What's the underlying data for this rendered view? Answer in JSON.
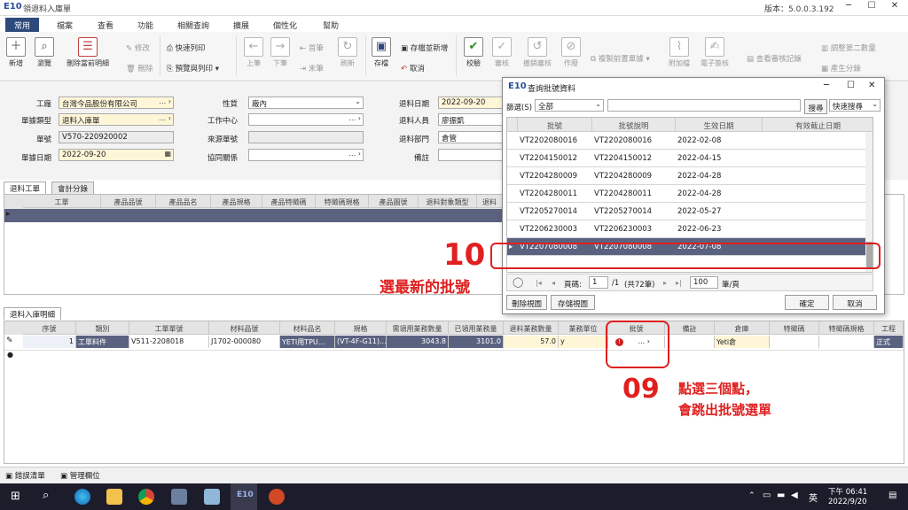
{
  "window": {
    "logo": "E10",
    "title": "領退料入庫單",
    "version": "版本：5.0.0.3.192"
  },
  "menu_tabs": [
    "常用",
    "檔案",
    "查看",
    "功能",
    "相關查詢",
    "擴展",
    "個性化",
    "幫助"
  ],
  "ribbon": {
    "new": "新增",
    "browse": "瀏覽",
    "delete_current": "刪除當前明細",
    "modify": "修改",
    "remove": "刪除",
    "quick_print": "快速列印",
    "preview_print": "預覽與列印",
    "prev": "上筆",
    "next": "下筆",
    "first": "首筆",
    "last": "末筆",
    "refresh": "刷新",
    "save": "存檔",
    "save_add": "存檔並新增",
    "cancel": "取消",
    "validate": "校驗",
    "approve": "審核",
    "undo_approve": "撤銷審核",
    "void": "作廢",
    "copy_prev": "複製前置單據",
    "attach": "附加檔",
    "esign": "電子簽核",
    "view_log": "查看審核記錄",
    "adjust_qty": "調整第二數量",
    "gen_batch": "產生分錄"
  },
  "form": {
    "factory_label": "工廠",
    "factory_value": "台灣今品股份有限公司",
    "doctype_label": "單據類型",
    "doctype_value": "退料入庫單",
    "docno_label": "單號",
    "docno_value": "V570-220920002",
    "docdate_label": "單據日期",
    "docdate_value": "2022-09-20",
    "nature_label": "性質",
    "nature_value": "廠內",
    "workcenter_label": "工作中心",
    "source_label": "來源單號",
    "related_label": "協同關係",
    "retdate_label": "退料日期",
    "retdate_value": "2022-09-20",
    "retperson_label": "退料人員",
    "retperson_value": "廖振凱",
    "retdept_label": "退料部門",
    "retdept_value": "倉管",
    "remark_label": "備註"
  },
  "upper_tabs": [
    "退料工單",
    "會計分錄"
  ],
  "upper_grid_headers": [
    "工單",
    "產品品號",
    "產品品名",
    "產品規格",
    "產品特徵碼",
    "特徵碼規格",
    "產品圖號",
    "退料對象類型",
    "退料"
  ],
  "lower_tab": "退料入庫明細",
  "lower_grid_headers": [
    "序號",
    "類別",
    "工單單號",
    "材料品號",
    "材料品名",
    "規格",
    "需領用業務數量",
    "已領用業務量",
    "退料業務數量",
    "業務單位",
    "批號",
    "備註",
    "倉庫",
    "特徵碼",
    "特徵碼規格",
    "工程"
  ],
  "lower_grid_row": [
    "1",
    "工單料件",
    "V511-2208018",
    "J1702-000080",
    "YETI用TPU...",
    "(VT-4F-G11)...",
    "3043.8",
    "3101.0",
    "57.0",
    "y",
    "...",
    "",
    "Yeti倉",
    "",
    "",
    "正式"
  ],
  "bottom_tabs": [
    "錯誤清單",
    "管理欄位"
  ],
  "dialog": {
    "logo": "E10",
    "title": "查詢批號資料",
    "filter_label": "篩選(S)",
    "filter_value": "全部",
    "search_btn": "搜尋",
    "quick_search": "快速搜尋",
    "headers": [
      "批號",
      "批號說明",
      "生效日期",
      "有效截止日期"
    ],
    "rows": [
      [
        "VT2202080016",
        "VT2202080016",
        "2022-02-08",
        ""
      ],
      [
        "VT2204150012",
        "VT2204150012",
        "2022-04-15",
        ""
      ],
      [
        "VT2204280009",
        "VT2204280009",
        "2022-04-28",
        ""
      ],
      [
        "VT2204280011",
        "VT2204280011",
        "2022-04-28",
        ""
      ],
      [
        "VT2205270014",
        "VT2205270014",
        "2022-05-27",
        ""
      ],
      [
        "VT2206230003",
        "VT2206230003",
        "2022-06-23",
        ""
      ],
      [
        "VT2207080008",
        "VT2207080008",
        "2022-07-08",
        ""
      ]
    ],
    "selected_row": 6,
    "page_label": "頁碼:",
    "page_value": "1",
    "page_total": "/1",
    "total_count": "(共72筆)",
    "per_page_value": "100",
    "per_page_label": "筆/頁",
    "remove_view": "刪除視圖",
    "save_view": "存儲視圖",
    "ok": "確定",
    "cancel": "取消"
  },
  "annotations": {
    "step10_num": "10",
    "step10_text": "選最新的批號",
    "step09_num": "09",
    "step09_line1": "點選三個點，",
    "step09_line2": "會跳出批號選單"
  },
  "taskbar": {
    "ime": "英",
    "time": "下午 06:41",
    "date": "2022/9/20"
  },
  "colors": {
    "accent": "#2e4a7c",
    "annotation": "#e02020",
    "selected_row": "#5a6280",
    "required_field": "#fff6d8"
  }
}
